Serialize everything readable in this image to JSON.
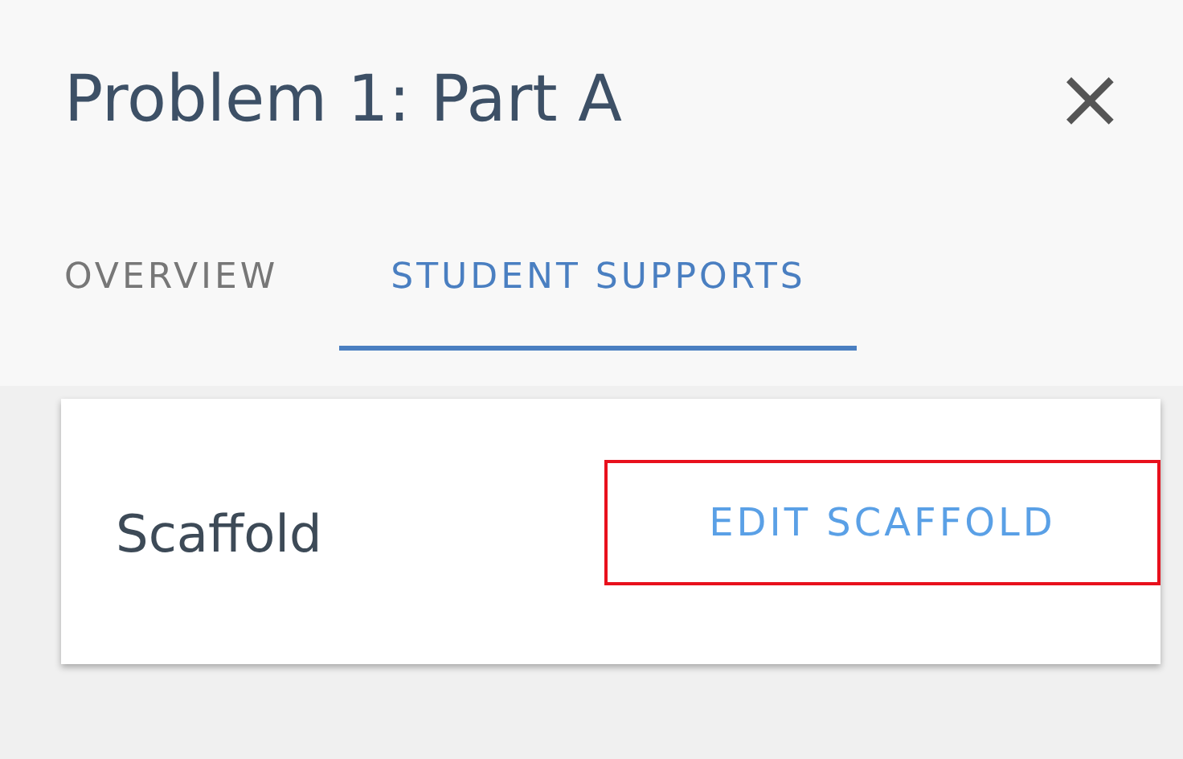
{
  "dialog": {
    "title": "Problem 1: Part A",
    "close": "×"
  },
  "tabs": [
    {
      "label": "OVERVIEW",
      "selected": false
    },
    {
      "label": "STUDENT SUPPORTS",
      "selected": true
    }
  ],
  "card": {
    "label": "Scaffold",
    "button": {
      "label": "EDIT SCAFFOLD",
      "highlighted": true
    }
  }
}
